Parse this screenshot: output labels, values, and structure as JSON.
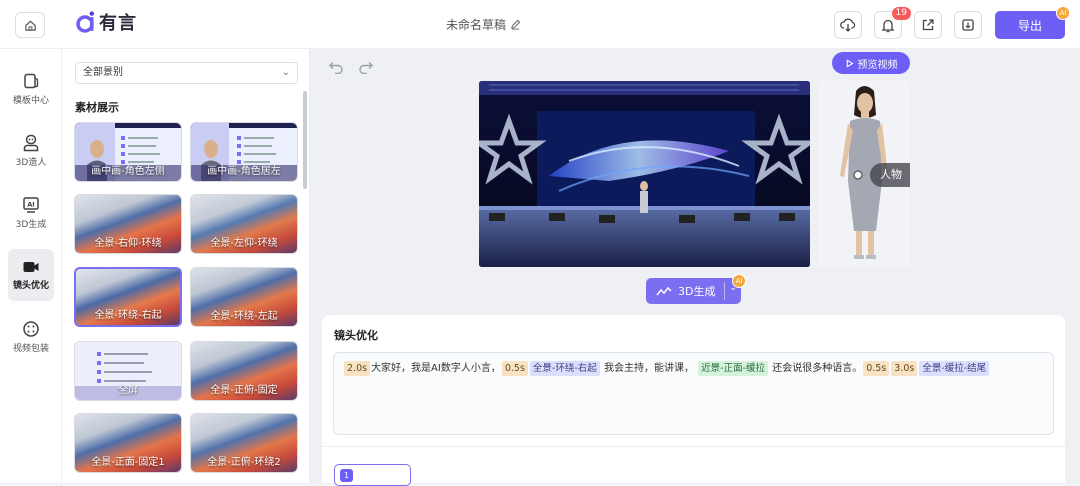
{
  "header": {
    "app_name": "有言",
    "doc_title": "未命名草稿",
    "notification_count": "19",
    "export_label": "导出",
    "ai_badge": "AI"
  },
  "sidebar": {
    "items": [
      {
        "label": "模板中心",
        "icon": "template-icon"
      },
      {
        "label": "3D造人",
        "icon": "avatar-icon"
      },
      {
        "label": "3D生成",
        "icon": "ai-generate-icon"
      },
      {
        "label": "镜头优化",
        "icon": "camera-icon"
      },
      {
        "label": "视频包装",
        "icon": "package-icon"
      }
    ]
  },
  "assets": {
    "filter_value": "全部景别",
    "section_title": "素材展示",
    "thumbs": [
      {
        "label": "画中画-角色左侧"
      },
      {
        "label": "画中画-角色居左"
      },
      {
        "label": "全景-右仰-环绕"
      },
      {
        "label": "全景-左仰-环绕"
      },
      {
        "label": "全景-环绕-右起"
      },
      {
        "label": "全景-环绕-左起"
      },
      {
        "label": "全屏"
      },
      {
        "label": "全景-正俯-固定"
      },
      {
        "label": "全景-正面-固定1"
      },
      {
        "label": "全景-正俯-环绕2"
      }
    ]
  },
  "canvas": {
    "preview_label": "预览视频",
    "person_label": "人物",
    "generate_label": "3D生成",
    "panel_title": "镜头优化",
    "script": [
      {
        "type": "time",
        "text": "2.0s"
      },
      {
        "type": "text",
        "text": "大家好，我是AI数字人小言，"
      },
      {
        "type": "time",
        "text": "0.5s"
      },
      {
        "type": "cam",
        "text": "全景-环绕-右起"
      },
      {
        "type": "text",
        "text": "我会主持，能讲课，"
      },
      {
        "type": "green",
        "text": "近景-正面-缓拉"
      },
      {
        "type": "text",
        "text": "还会说很多种语言。"
      },
      {
        "type": "time",
        "text": "0.5s"
      },
      {
        "type": "time",
        "text": "3.0s"
      },
      {
        "type": "cam",
        "text": "全景-缓拉-结尾"
      }
    ],
    "clip_number": "1"
  },
  "colors": {
    "accent": "#6d5ff5",
    "badge": "#f45b5b",
    "ai_badge": "#f3a63c"
  }
}
